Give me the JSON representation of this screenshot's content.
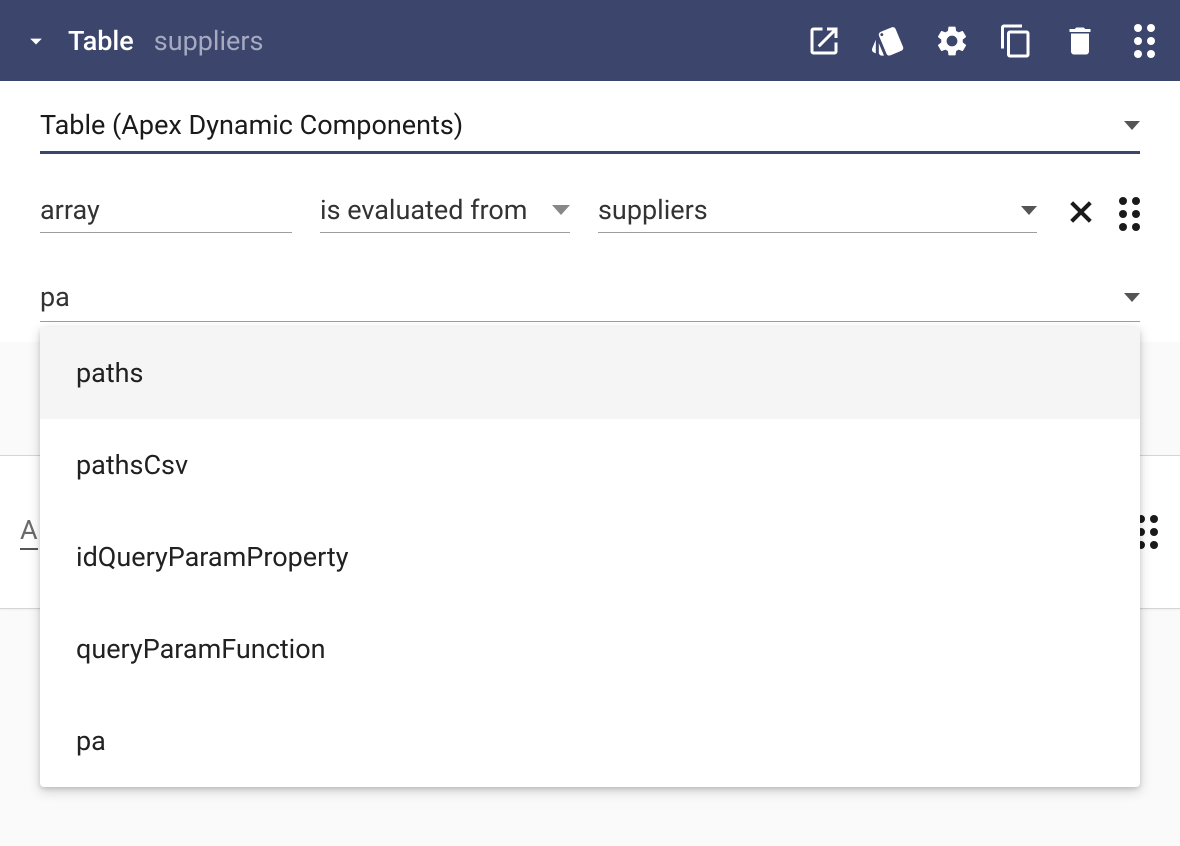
{
  "header": {
    "title": "Table",
    "subtitle": "suppliers"
  },
  "component_select": {
    "label": "Table (Apex Dynamic Components)"
  },
  "row1": {
    "property": "array",
    "operator": "is evaluated from",
    "value": "suppliers"
  },
  "autocomplete": {
    "query": "pa",
    "options": [
      "paths",
      "pathsCsv",
      "idQueryParamProperty",
      "queryParamFunction",
      "pa"
    ]
  },
  "background_row": {
    "label_fragment": "A"
  }
}
